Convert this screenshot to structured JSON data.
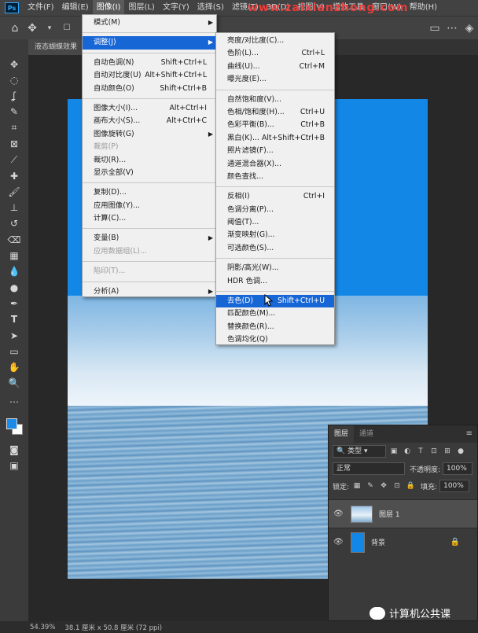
{
  "menubar": {
    "logo": "Ps",
    "items": [
      "文件(F)",
      "编辑(E)",
      "图像(I)",
      "图层(L)",
      "文字(Y)",
      "选择(S)",
      "滤镜(T)",
      "3D(D)",
      "视图(V)",
      "增效工具",
      "窗口(W)",
      "帮助(H)"
    ],
    "active_index": 2,
    "watermark": "www.zaixianzhong.com"
  },
  "document_tab": "液态蝴蝶效果",
  "image_menu": [
    {
      "label": "模式(M)",
      "shortcut": "",
      "submenu": true
    },
    {
      "sep": true
    },
    {
      "label": "调整(J)",
      "shortcut": "",
      "submenu": true,
      "highlight": true
    },
    {
      "sep": true
    },
    {
      "label": "自动色调(N)",
      "shortcut": "Shift+Ctrl+L"
    },
    {
      "label": "自动对比度(U)",
      "shortcut": "Alt+Shift+Ctrl+L"
    },
    {
      "label": "自动颜色(O)",
      "shortcut": "Shift+Ctrl+B"
    },
    {
      "sep": true
    },
    {
      "label": "图像大小(I)...",
      "shortcut": "Alt+Ctrl+I"
    },
    {
      "label": "画布大小(S)...",
      "shortcut": "Alt+Ctrl+C"
    },
    {
      "label": "图像旋转(G)",
      "shortcut": "",
      "submenu": true
    },
    {
      "label": "裁剪(P)",
      "shortcut": "",
      "disabled": true
    },
    {
      "label": "裁切(R)...",
      "shortcut": ""
    },
    {
      "label": "显示全部(V)",
      "shortcut": ""
    },
    {
      "sep": true
    },
    {
      "label": "复制(D)...",
      "shortcut": ""
    },
    {
      "label": "应用图像(Y)...",
      "shortcut": ""
    },
    {
      "label": "计算(C)...",
      "shortcut": ""
    },
    {
      "sep": true
    },
    {
      "label": "变量(B)",
      "shortcut": "",
      "submenu": true
    },
    {
      "label": "应用数据组(L)...",
      "shortcut": "",
      "disabled": true
    },
    {
      "sep": true
    },
    {
      "label": "陷印(T)...",
      "shortcut": "",
      "disabled": true
    },
    {
      "sep": true
    },
    {
      "label": "分析(A)",
      "shortcut": "",
      "submenu": true
    }
  ],
  "adjust_menu": [
    {
      "label": "亮度/对比度(C)...",
      "shortcut": ""
    },
    {
      "label": "色阶(L)...",
      "shortcut": "Ctrl+L"
    },
    {
      "label": "曲线(U)...",
      "shortcut": "Ctrl+M"
    },
    {
      "label": "曝光度(E)...",
      "shortcut": ""
    },
    {
      "sep": true
    },
    {
      "label": "自然饱和度(V)...",
      "shortcut": ""
    },
    {
      "label": "色相/饱和度(H)...",
      "shortcut": "Ctrl+U"
    },
    {
      "label": "色彩平衡(B)...",
      "shortcut": "Ctrl+B"
    },
    {
      "label": "黑白(K)...",
      "shortcut": "Alt+Shift+Ctrl+B"
    },
    {
      "label": "照片滤镜(F)...",
      "shortcut": ""
    },
    {
      "label": "通道混合器(X)...",
      "shortcut": ""
    },
    {
      "label": "颜色查找...",
      "shortcut": ""
    },
    {
      "sep": true
    },
    {
      "label": "反相(I)",
      "shortcut": "Ctrl+I"
    },
    {
      "label": "色调分离(P)...",
      "shortcut": ""
    },
    {
      "label": "阈值(T)...",
      "shortcut": ""
    },
    {
      "label": "渐变映射(G)...",
      "shortcut": ""
    },
    {
      "label": "可选颜色(S)...",
      "shortcut": ""
    },
    {
      "sep": true
    },
    {
      "label": "阴影/高光(W)...",
      "shortcut": ""
    },
    {
      "label": "HDR 色调...",
      "shortcut": ""
    },
    {
      "sep": true
    },
    {
      "label": "去色(D)",
      "shortcut": "Shift+Ctrl+U",
      "highlight": true
    },
    {
      "label": "匹配颜色(M)...",
      "shortcut": ""
    },
    {
      "label": "替换颜色(R)...",
      "shortcut": ""
    },
    {
      "label": "色调均化(Q)",
      "shortcut": ""
    }
  ],
  "layers_panel": {
    "tabs": [
      "图层",
      "通道"
    ],
    "filter_label": "类型",
    "blend_mode": "正常",
    "opacity_label": "不透明度:",
    "opacity_value": "100%",
    "lock_label": "锁定:",
    "fill_label": "填充:",
    "fill_value": "100%",
    "layers": [
      {
        "name": "图层 1",
        "selected": true
      },
      {
        "name": "背景",
        "selected": false
      }
    ]
  },
  "statusbar": {
    "zoom": "54.39%",
    "doc_info": "38.1 厘米 x 50.8 厘米 (72 ppi)"
  },
  "watermark_bottom": "计算机公共课",
  "colors": {
    "accent": "#1766d6",
    "foreground": "#1b8ae8",
    "background": "#ffffff"
  }
}
